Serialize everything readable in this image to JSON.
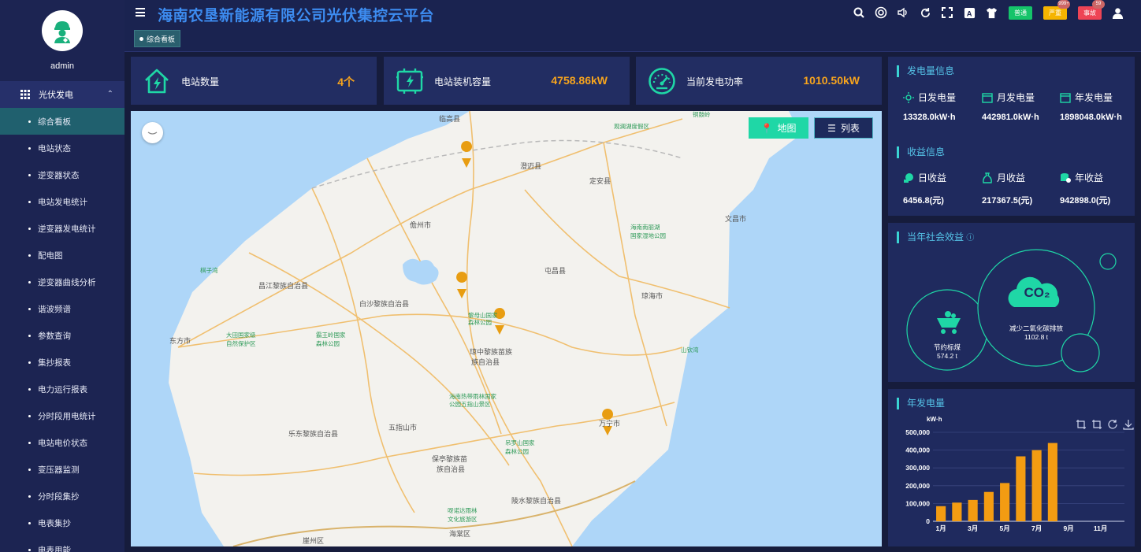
{
  "user": {
    "name": "admin"
  },
  "app": {
    "title": "海南农垦新能源有限公司光伏集控云平台",
    "active_tab": "综合看板"
  },
  "alarms": [
    {
      "label": "普通",
      "color": "#15c46a",
      "badge": ""
    },
    {
      "label": "严重",
      "color": "#f5b400",
      "badge": "999+"
    },
    {
      "label": "事故",
      "color": "#ee4455",
      "badge": "59"
    }
  ],
  "sidebar": {
    "group": "光伏发电",
    "items": [
      {
        "label": "综合看板",
        "active": true
      },
      {
        "label": "电站状态"
      },
      {
        "label": "逆变器状态"
      },
      {
        "label": "电站发电统计"
      },
      {
        "label": "逆变器发电统计"
      },
      {
        "label": "配电图"
      },
      {
        "label": "逆变器曲线分析"
      },
      {
        "label": "谐波频谱"
      },
      {
        "label": "参数查询"
      },
      {
        "label": "集抄报表"
      },
      {
        "label": "电力运行报表"
      },
      {
        "label": "分时段用电统计"
      },
      {
        "label": "电站电价状态"
      },
      {
        "label": "变压器监测"
      },
      {
        "label": "分时段集抄"
      },
      {
        "label": "电表集抄"
      },
      {
        "label": "电表用能"
      }
    ]
  },
  "stats": [
    {
      "label": "电站数量",
      "value": "4个",
      "icon": "home-bolt-icon"
    },
    {
      "label": "电站装机容量",
      "value": "4758.86kW",
      "icon": "battery-bolt-icon"
    },
    {
      "label": "当前发电功率",
      "value": "1010.50kW",
      "icon": "speedometer-icon"
    }
  ],
  "map": {
    "btn_map": "地图",
    "btn_list": "列表",
    "labels": [
      "临高县",
      "澄迈县",
      "定安县",
      "儋州市",
      "文昌市",
      "屯昌县",
      "琼海市",
      "昌江黎族自治县",
      "白沙黎族自治县",
      "东方市",
      "琼中黎族苗族自治县",
      "五指山市",
      "万宁市",
      "乐东黎族自治县",
      "保亭黎族苗族自治县",
      "陵水黎族自治县",
      "海棠区",
      "崖州区",
      "棋子湾",
      "观澜湖度假区",
      "铜鼓岭",
      "海南南丽湖国家湿地公园",
      "黎母山国家森林公园",
      "大田国家级自然保护区",
      "霸王岭国家森林公园",
      "海南热带雨林国家公园五指山景区",
      "吊罗山国家森林公园",
      "山钦湾",
      "呀诺达雨林文化旅游区"
    ]
  },
  "generation": {
    "title": "发电量信息",
    "items": [
      {
        "label": "日发电量",
        "value": "13328.0kW·h"
      },
      {
        "label": "月发电量",
        "value": "442981.0kW·h"
      },
      {
        "label": "年发电量",
        "value": "1898048.0kW·h"
      }
    ]
  },
  "income": {
    "title": "收益信息",
    "items": [
      {
        "label": "日收益",
        "value": "6456.8(元)"
      },
      {
        "label": "月收益",
        "value": "217367.5(元)"
      },
      {
        "label": "年收益",
        "value": "942898.0(元)"
      }
    ]
  },
  "social": {
    "title": "当年社会效益",
    "coal_label": "节约标煤",
    "coal_value": "574.2 t",
    "co2_label": "减少二氧化碳排放",
    "co2_value": "1102.8 t",
    "co2_icon_text": "CO₂"
  },
  "colors": {
    "accent": "#3d8cf0",
    "value": "#f7a41d",
    "teal": "#1fd7a6",
    "bar": "#f39c12"
  },
  "chart_data": {
    "type": "bar",
    "title": "年发电量",
    "ylabel": "kW·h",
    "ylim": [
      0,
      500000
    ],
    "yticks": [
      "500,000",
      "400,000",
      "300,000",
      "200,000",
      "100,000",
      "0"
    ],
    "categories": [
      "1月",
      "2月",
      "3月",
      "4月",
      "5月",
      "6月",
      "7月",
      "8月",
      "9月",
      "10月",
      "11月",
      "12月"
    ],
    "xtick_labels": [
      "1月",
      "3月",
      "5月",
      "7月",
      "9月",
      "11月"
    ],
    "values": [
      85000,
      105000,
      120000,
      165000,
      215000,
      365000,
      400000,
      440000,
      0,
      0,
      0,
      0
    ]
  }
}
